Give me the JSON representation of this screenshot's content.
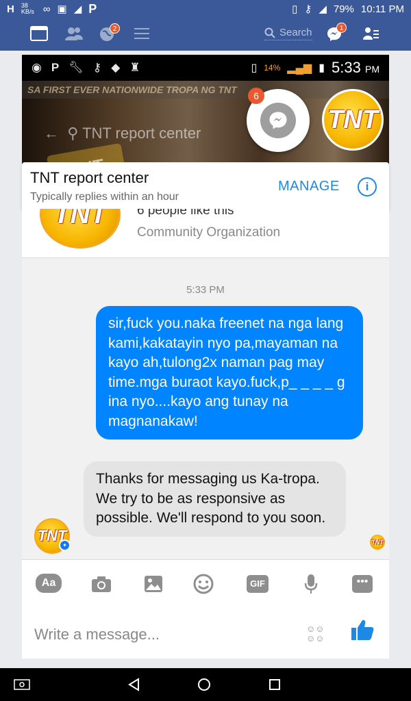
{
  "status_bar": {
    "network": "H",
    "speed": "38 KB/s",
    "p_icon": "P",
    "battery": "79%",
    "time": "10:11 PM"
  },
  "fb_bar": {
    "notifications_badge": "2",
    "search_label": "Search",
    "messages_badge": "1"
  },
  "screenshot": {
    "inner_status": {
      "p_icon": "P",
      "signal_percent": "14%",
      "time": "5:33",
      "am_pm": "PM"
    },
    "cover": {
      "banner_text": "SA FIRST EVER NATIONWIDE TROPA NG TNT",
      "search_ghost": "TNT report center",
      "tropa_text": "TNT"
    },
    "chat_head_badge": "6",
    "page_logo_text": "TNT",
    "header": {
      "name": "TNT report center",
      "subtitle": "Typically replies within an hour",
      "manage_label": "MANAGE",
      "info_icon": "i"
    },
    "page_card": {
      "logo_text": "TNT",
      "likes_text": "6 people like this",
      "category": "Community Organization"
    },
    "chat": {
      "timestamp": "5:33 PM",
      "outgoing_message": "sir,fuck you.naka freenet na nga lang kami,kakatayin nyo pa,mayaman na kayo ah,tulong2x naman pag may time.mga buraot kayo.fuck,p_ _ _ _ g ina nyo....kayo ang tunay na magnanakaw!",
      "incoming_message": "Thanks for messaging us Ka-tropa. We try to be as responsive as possible. We'll respond to you soon.",
      "avatar_text": "TNT",
      "seen_avatar_text": "TNT"
    },
    "composer": {
      "aa_label": "Aa",
      "gif_label": "GIF",
      "placeholder": "Write a message..."
    }
  },
  "colors": {
    "facebook_blue": "#3b5998",
    "messenger_blue": "#0084ff",
    "accent_blue": "#1e88e5",
    "badge_orange": "#e9582e"
  }
}
